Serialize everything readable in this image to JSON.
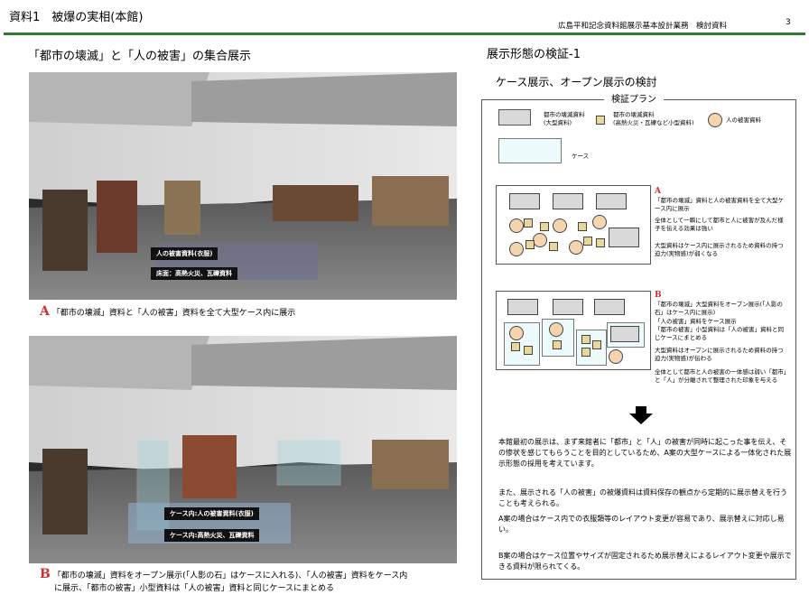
{
  "header": {
    "title": "資料1　被爆の実相(本館)",
    "subtitle": "広島平和記念資料館展示基本設計業務　検討資料",
    "page": "3"
  },
  "left": {
    "heading": "「都市の壊滅」と「人の被害」の集合展示",
    "photoA": {
      "label1": "人の被害資料(衣服)",
      "label2": "床面：高熱火災、瓦礫資料"
    },
    "captionA": {
      "letter": "A",
      "text": "「都市の壊滅」資料と「人の被害」資料を全て大型ケース内に展示"
    },
    "photoB": {
      "label1": "ケース内:人の被害資料(衣服)",
      "label2": "ケース内:高熱火災、瓦礫資料"
    },
    "captionB": {
      "letter": "B",
      "line1": "「都市の壊滅」資料をオープン展示(「人影の石」はケースに入れる)、「人の被害」資料をケース内",
      "line2": "に展示、「都市の被害」小型資料は「人の被害」資料と同じケースにまとめる"
    }
  },
  "right": {
    "heading": "展示形態の検証-1",
    "subheading": "ケース展示、オープン展示の検討",
    "plan_title": "検証プラン",
    "legend": {
      "urban_large": "都市の壊滅資料\n(大型資料)",
      "urban_small": "都市の壊滅資料\n(高熱火災・瓦礫など小型資料)",
      "human": "人の被害資料",
      "case": "ケース"
    },
    "planA": {
      "letter": "A",
      "notes": [
        "「都市の壊滅」資料と人の被害資料を全て大型ケース内に展示",
        "全体として一瞬にして都市と人に被害が及んだ様子を伝える効果は強い",
        "大型資料はケース内に展示されるため資料の持つ迫力(実物感)が弱くなる"
      ]
    },
    "planB": {
      "letter": "B",
      "notes": [
        "「都市の壊滅」大型資料をオープン展示(「人影の石」はケース内に展示)",
        "「人の被害」資料をケース展示",
        "「都市の被害」小型資料は「人の被害」資料と同じケースにまとめる",
        "大型資料はオープンに展示されるため資料の持つ迫力(実物感)が伝わる",
        "全体として都市と人の被害の一体感は弱い「都市」と「人」が分離されて整理された印象を与える"
      ]
    },
    "body": [
      "本館最初の展示は、まず来館者に「都市」と「人」の被害が同時に起こった事を伝え、その惨状を感じてもらうことを目的としているため、A案の大型ケースによる一体化された展示形態の採用を考えています。",
      "また、展示される「人の被害」の被爆資料は資料保存の観点から定期的に展示替えを行うことも考えられる。",
      "A案の場合はケース内での衣服類等のレイアウト変更が容易であり、展示替えに対応し易い。",
      "B案の場合はケース位置やサイズが固定されるため展示替えによるレイアウト変更や展示できる資料が限られてくる。"
    ]
  }
}
